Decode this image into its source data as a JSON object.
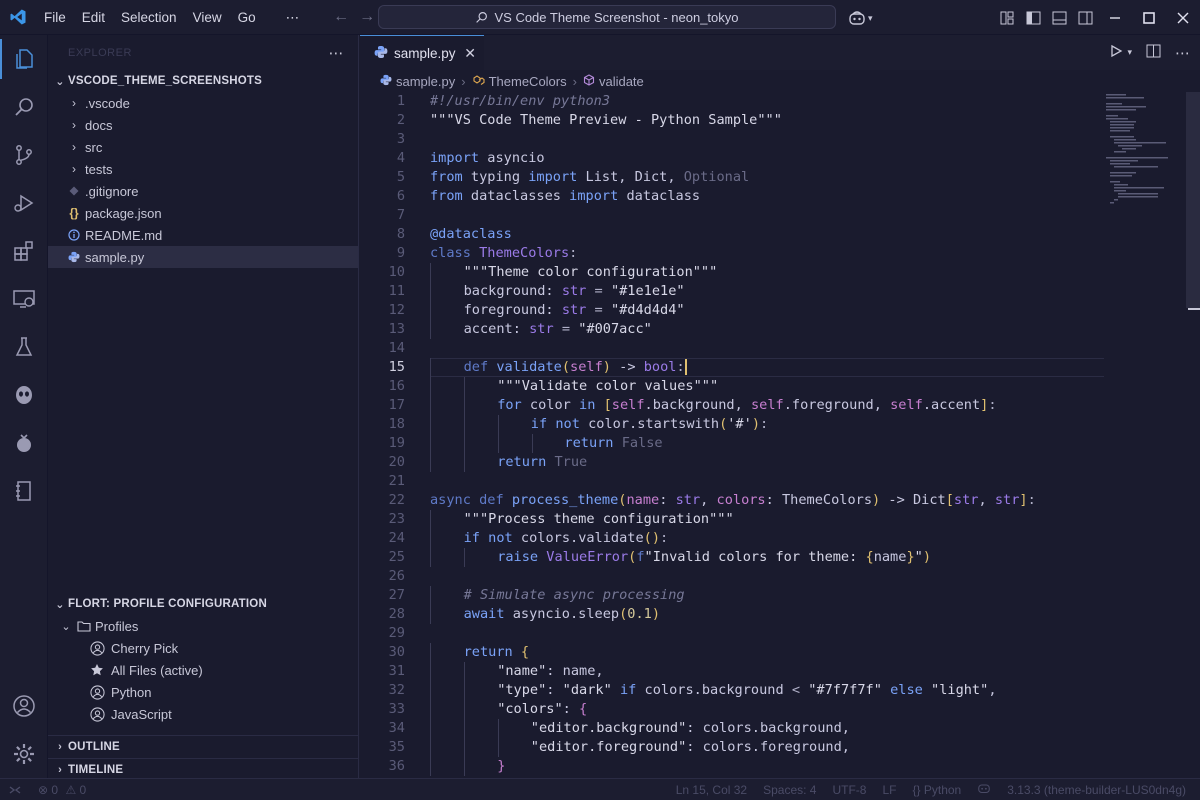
{
  "colors": {
    "accent": "#4a8fd8",
    "background": "#1a1b2e",
    "chrome": "#1c1d30"
  },
  "menu": [
    "File",
    "Edit",
    "Selection",
    "View",
    "Go"
  ],
  "window_title": "VS Code Theme Screenshot - neon_tokyo",
  "sidebar": {
    "header": "EXPLORER",
    "folder": "VSCODE_THEME_SCREENSHOTS",
    "items": [
      {
        "label": ".vscode",
        "type": "folder"
      },
      {
        "label": "docs",
        "type": "folder"
      },
      {
        "label": "src",
        "type": "folder"
      },
      {
        "label": "tests",
        "type": "folder"
      },
      {
        "label": ".gitignore",
        "type": "gitignore"
      },
      {
        "label": "package.json",
        "type": "json"
      },
      {
        "label": "README.md",
        "type": "info"
      },
      {
        "label": "sample.py",
        "type": "python",
        "selected": true
      }
    ],
    "profile_section": "FLORT: PROFILE CONFIGURATION",
    "profiles_label": "Profiles",
    "profiles": [
      {
        "label": "Cherry Pick",
        "icon": "person-icon"
      },
      {
        "label": "All Files (active)",
        "icon": "star-icon"
      },
      {
        "label": "Python",
        "icon": "person-icon"
      },
      {
        "label": "JavaScript",
        "icon": "person-icon"
      }
    ],
    "outline": "OUTLINE",
    "timeline": "TIMELINE"
  },
  "tab": {
    "label": "sample.py"
  },
  "breadcrumb": [
    "sample.py",
    "ThemeColors",
    "validate"
  ],
  "cursor_line": 15,
  "status": {
    "problems_errors": "0",
    "problems_warnings": "0",
    "position": "Ln 15, Col 32",
    "spaces": "Spaces: 4",
    "encoding": "UTF-8",
    "eol": "LF",
    "language": "Python",
    "interpreter": "3.13.3 (theme-builder-LUS0dn4g)"
  }
}
